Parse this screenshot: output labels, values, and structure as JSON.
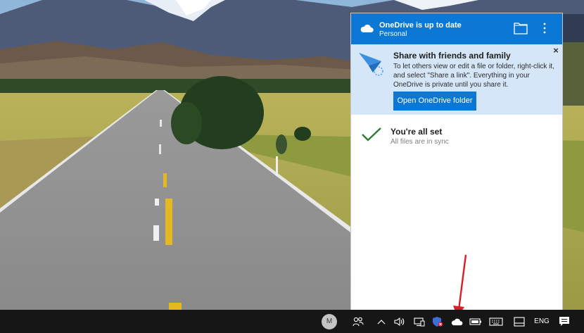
{
  "onedrive": {
    "title": "OneDrive is up to date",
    "account": "Personal",
    "share_banner": {
      "title": "Share with friends and family",
      "body": "To let others view or edit a file or folder, right-click it, and select \"Share a link\". Everything in your OneDrive is private until you share it.",
      "button": "Open OneDrive folder"
    },
    "status": {
      "title": "You're all set",
      "subtitle": "All files are in sync"
    }
  },
  "taskbar": {
    "avatar_initial": "M",
    "language": "ENG",
    "icons": [
      "people-icon",
      "chevron-up-icon",
      "volume-icon",
      "network-icon",
      "defender-icon",
      "onedrive-cloud-icon",
      "battery-icon",
      "touch-keyboard-icon",
      "tablet-mode-icon",
      "action-center-icon"
    ]
  },
  "colors": {
    "accent": "#0a78d4",
    "banner_bg": "#d4e6f7",
    "check": "#2e7d32",
    "annotation": "#d81f26",
    "taskbar": "#161616"
  }
}
